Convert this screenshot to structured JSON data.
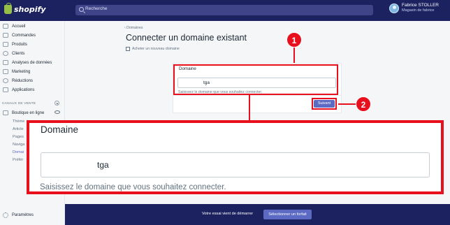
{
  "topbar": {
    "brand": "shopify",
    "search_placeholder": "Recherche",
    "user_name": "Fabrice STOLLER",
    "user_store": "Magasin de fabrice"
  },
  "sidebar": {
    "items": [
      {
        "label": "Accueil"
      },
      {
        "label": "Commandes"
      },
      {
        "label": "Produits"
      },
      {
        "label": "Clients"
      },
      {
        "label": "Analyses de données"
      },
      {
        "label": "Marketing"
      },
      {
        "label": "Réductions"
      },
      {
        "label": "Applications"
      }
    ],
    "sales_channels_label": "CANAUX DE VENTE",
    "online_store_label": "Boutique en ligne",
    "sub_items": [
      {
        "label": "Thème"
      },
      {
        "label": "Article"
      },
      {
        "label": "Pages"
      },
      {
        "label": "Naviga"
      },
      {
        "label": "Domai"
      },
      {
        "label": "Préfér"
      }
    ],
    "settings_label": "Paramètres"
  },
  "main": {
    "breadcrumb": "‹ Domaines",
    "title": "Connecter un domaine existant",
    "buy_link": "Acheter un nouveau domaine",
    "field_label": "Domaine",
    "field_value": "tga",
    "field_help": "Saisissez le domaine que vous souhaitez connecter.",
    "next_button": "Suivant"
  },
  "callouts": {
    "one": "1",
    "two": "2"
  },
  "zoom": {
    "title": "Domaine",
    "value": "tga",
    "help": "Saisissez le domaine que vous souhaitez connecter."
  },
  "trial": {
    "text": "Votre essai vient de démarrer",
    "button": "Sélectionner un forfait"
  },
  "colors": {
    "topbar": "#1c2260",
    "accent": "#5c6ac4",
    "annotation": "#e8101c"
  }
}
